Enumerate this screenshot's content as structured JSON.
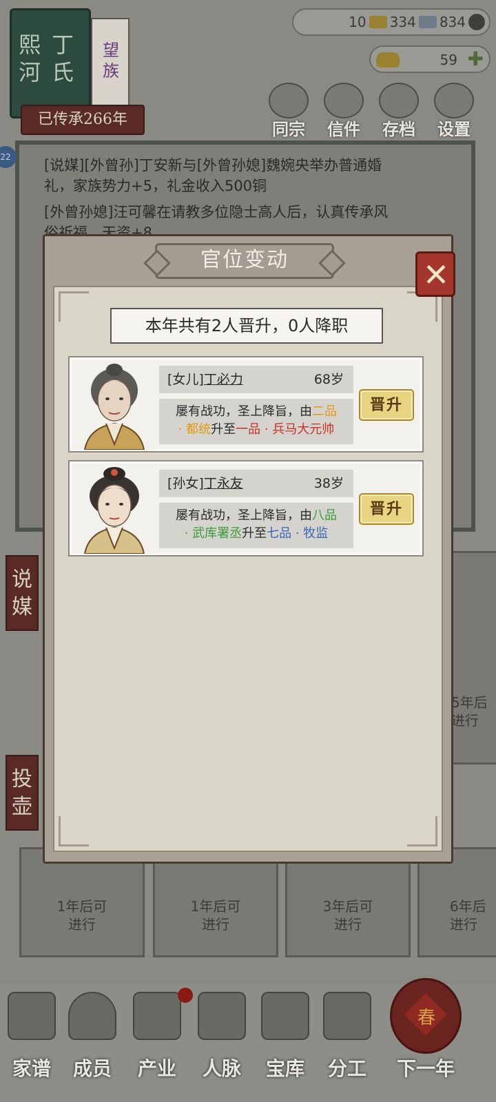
{
  "family": {
    "name_col1": "熙河",
    "name_col2": "丁氏",
    "rank_label": "望族",
    "heritage": "已传承266年"
  },
  "resources": {
    "gold": "10",
    "jade": "334",
    "copper": "834",
    "ingot": "59",
    "colors": {
      "gold": "#9a8132",
      "jade": "#6c7a8a"
    }
  },
  "top_menu": [
    {
      "label": "同宗",
      "icon": "clan-book-icon"
    },
    {
      "label": "信件",
      "icon": "letter-icon"
    },
    {
      "label": "存档",
      "icon": "scroll-save-icon"
    },
    {
      "label": "设置",
      "icon": "gear-icon"
    }
  ],
  "log": {
    "badge": "22",
    "line1": "[说媒][外曾孙]丁安新与[外曾孙媳]魏婉央举办普通婚",
    "line2": "礼，家族势力+5，礼金收入500铜",
    "line3": "[外曾孙媳]汪可馨在请教多位隐士高人后，认真传承风",
    "line4": "俗祈福，天资+8"
  },
  "side_tags": [
    "说媒",
    "投壶"
  ],
  "cards": [
    {
      "text1": "1年后可",
      "text2": "进行"
    },
    {
      "text1": "1年后可",
      "text2": "进行"
    },
    {
      "text1": "3年后可",
      "text2": "进行"
    },
    {
      "text1": "6年后",
      "text2": "进行"
    }
  ],
  "side_card": {
    "text1": "5年后",
    "text2": "进行"
  },
  "bottom_nav": [
    {
      "label": "家谱",
      "icon": "genealogy-book-icon"
    },
    {
      "label": "成员",
      "icon": "member-icon"
    },
    {
      "label": "产业",
      "icon": "building-icon"
    },
    {
      "label": "人脉",
      "icon": "network-icon"
    },
    {
      "label": "宝库",
      "icon": "treasure-chest-icon"
    },
    {
      "label": "分工",
      "icon": "scroll-icon"
    },
    {
      "label": "下一年",
      "icon": "lantern-icon"
    }
  ],
  "lantern_char": "春",
  "dialog": {
    "title": "官位变动",
    "summary": "本年共有2人晋升，0人降职",
    "people": [
      {
        "relation": "[女儿]",
        "name": "丁必力",
        "age": "68岁",
        "desc_prefix": "屡有战功，圣上降旨，由",
        "from_rank": "二品",
        "from_title": "· 都统",
        "mid": "升至",
        "to_rank": "一品",
        "to_title": " · 兵马大元帅",
        "button": "晋升"
      },
      {
        "relation": "[孙女]",
        "name": "丁永友",
        "age": "38岁",
        "desc_prefix": "屡有战功，圣上降旨，由",
        "from_rank": "八品",
        "from_title": "· 武库署丞",
        "mid": "升至",
        "to_rank": "七品",
        "to_title": " · 牧监",
        "button": "晋升"
      }
    ]
  }
}
